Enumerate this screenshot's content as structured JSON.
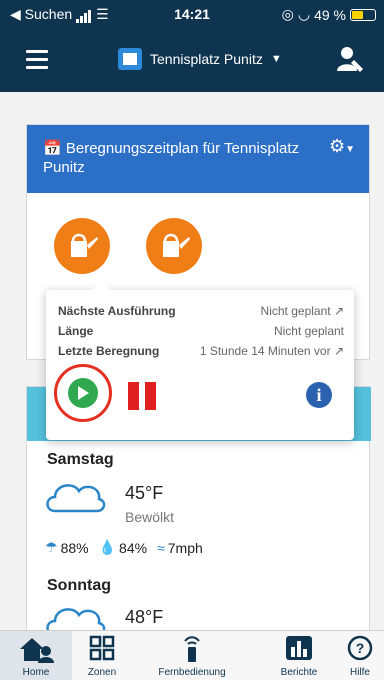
{
  "status": {
    "back_label": "◀ Suchen",
    "time": "14:21",
    "battery": "49 %"
  },
  "header": {
    "site_name": "Tennisplatz Punitz"
  },
  "schedule_card": {
    "title": "Beregnungszeitplan für Tennisplatz Punitz"
  },
  "popover": {
    "rows": [
      {
        "label": "Nächste Ausführung",
        "value": "Nicht geplant"
      },
      {
        "label": "Länge",
        "value": "Nicht geplant"
      },
      {
        "label": "Letzte Beregnung",
        "value": "1 Stunde 14 Minuten vor"
      }
    ]
  },
  "weather": {
    "days": [
      {
        "day": "Samstag",
        "temp": "45°F",
        "condition": "Bewölkt",
        "precip": "88%",
        "humidity": "84%",
        "wind": "7mph"
      },
      {
        "day": "Sonntag",
        "temp": "48°F"
      }
    ]
  },
  "tabs": [
    {
      "label": "Home",
      "icon": "home-icon"
    },
    {
      "label": "Zonen",
      "icon": "grid-icon"
    },
    {
      "label": "Fernbedienung",
      "icon": "remote-icon"
    },
    {
      "label": "Berichte",
      "icon": "chart-icon"
    },
    {
      "label": "Hilfe",
      "icon": "help-icon"
    }
  ],
  "colors": {
    "nav": "#0f3450",
    "card_header": "#2c6fc7",
    "zone": "#f07e17",
    "play": "#2fa84f",
    "pause": "#e02020",
    "weather_band": "#55c1dc"
  }
}
